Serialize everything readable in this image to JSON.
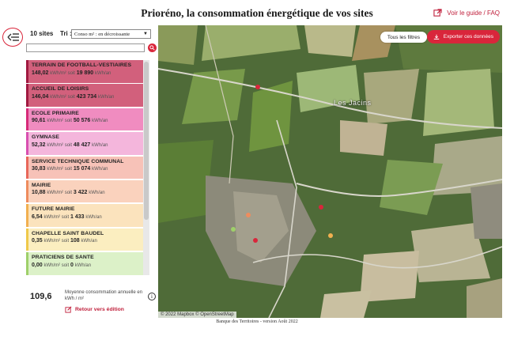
{
  "header": {
    "title": "Prioréno, la consommation énergétique de vos sites",
    "guide_link": "Voir le guide / FAQ"
  },
  "sidebar": {
    "count": "10 sites",
    "sort_label": "Tri :",
    "sort_value": "Conso m² : en décroissante",
    "search_placeholder": "",
    "sites": [
      {
        "name": "TERRAIN DE FOOTBALL-VESTIAIRES",
        "value": "148,02",
        "unit": "kWh/m² soit",
        "total": "19 890",
        "total_unit": "kWh/an",
        "color": "#a01840",
        "bg": "#d2607c"
      },
      {
        "name": "ACCUEIL DE LOISIRS",
        "value": "146,04",
        "unit": "kWh/m² soit",
        "total": "423 734",
        "total_unit": "kWh/an",
        "color": "#a01840",
        "bg": "#d2607c"
      },
      {
        "name": "ECOLE PRIMAIRE",
        "value": "90,61",
        "unit": "kWh/m² soit",
        "total": "50 576",
        "total_unit": "kWh/an",
        "color": "#d62a78",
        "bg": "#f08cc0"
      },
      {
        "name": "GYMNASE",
        "value": "52,32",
        "unit": "kWh/m² soit",
        "total": "48 427",
        "total_unit": "kWh/an",
        "color": "#d84fb0",
        "bg": "#f4b6dc"
      },
      {
        "name": "SERVICE TECHNIQUE COMMUNAL",
        "value": "30,83",
        "unit": "kWh/m² soit",
        "total": "15 074",
        "total_unit": "kWh/an",
        "color": "#e8675a",
        "bg": "#f7c2b8"
      },
      {
        "name": "MAIRIE",
        "value": "10,88",
        "unit": "kWh/m² soit",
        "total": "3 422",
        "total_unit": "kWh/an",
        "color": "#ee8c5e",
        "bg": "#fad2bd"
      },
      {
        "name": "FUTURE MAIRIE",
        "value": "6,54",
        "unit": "kWh/m² soit",
        "total": "1 433",
        "total_unit": "kWh/an",
        "color": "#f2b050",
        "bg": "#fbe3bd"
      },
      {
        "name": "CHAPELLE SAINT BAUDEL",
        "value": "0,35",
        "unit": "kWh/m² soit",
        "total": "108",
        "total_unit": "kWh/an",
        "color": "#efc94a",
        "bg": "#fbeec0"
      },
      {
        "name": "PRATICIENS DE SANTE",
        "value": "0,00",
        "unit": "kWh/m² soit",
        "total": "0",
        "total_unit": "kWh/an",
        "color": "#9fd06a",
        "bg": "#dcf1c8"
      }
    ],
    "avg_value": "109,6",
    "avg_label": "Moyenne consommation annuelle en kWh / m²",
    "back_edit": "Retour vers édition"
  },
  "map": {
    "filters_button": "Tous les filtres",
    "export_button": "Exporter ces données",
    "place_label": "Les Jacins",
    "attribution": "© 2022 Mapbox  © OpenStreetMap"
  },
  "footer": {
    "text": "Banque des Territoires - version Août 2022"
  },
  "colors": {
    "accent": "#d9263b"
  }
}
